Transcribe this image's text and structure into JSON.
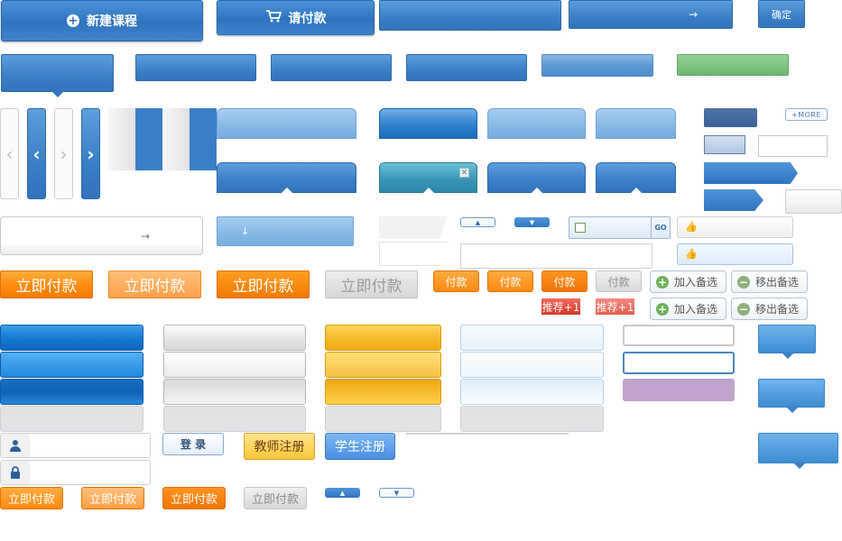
{
  "colors": {
    "blue_primary": "#3a7fc4",
    "orange_primary": "#ff8b0f",
    "green_button": "#78c07e",
    "purple_block": "#bfa3cc",
    "red_badge": "#d9352a"
  },
  "top_buttons": {
    "new_course": "新建课程",
    "new_course_icon": "plus-circle-icon",
    "pay": "请付款",
    "pay_icon": "cart-icon",
    "arrow_glyph": "→",
    "confirm": "确定"
  },
  "small_links": {
    "more": "+MORE",
    "go": "GO"
  },
  "glyphs": {
    "arrow_down": "↓",
    "chev_left": "‹",
    "chev_right": "›",
    "close": "✕",
    "plus": "+",
    "minus": "−",
    "user": "👤",
    "lock": "🔒",
    "thumb": "👍",
    "tri_up": "▲",
    "tri_down": "▼"
  },
  "pay_buttons_large": {
    "label": "立即付款"
  },
  "pay_buttons_small": {
    "label": "付款"
  },
  "badges": {
    "recommend": "推荐+1"
  },
  "watchlist": {
    "add": "加入备选",
    "remove": "移出备选"
  },
  "login_form": {
    "user_icon": "user-icon",
    "lock_icon": "lock-icon",
    "login": "登 录",
    "teacher_register": "教师注册",
    "student_register": "学生注册"
  },
  "pay_buttons_bottom": {
    "label": "立即付款"
  }
}
